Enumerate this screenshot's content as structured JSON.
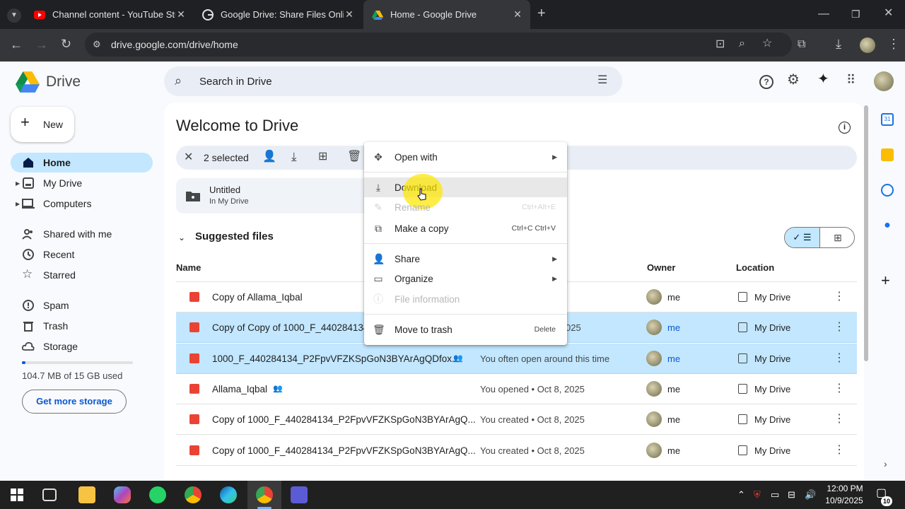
{
  "browser": {
    "tabs": [
      {
        "title": "Channel content - YouTube Stu"
      },
      {
        "title": "Google Drive: Share Files Onlin"
      },
      {
        "title": "Home - Google Drive"
      }
    ],
    "url": "drive.google.com/drive/home"
  },
  "drive": {
    "product_name": "Drive",
    "search_placeholder": "Search in Drive",
    "new_button": "New",
    "nav": [
      {
        "label": "Home"
      },
      {
        "label": "My Drive"
      },
      {
        "label": "Computers"
      },
      {
        "label": "Shared with me"
      },
      {
        "label": "Recent"
      },
      {
        "label": "Starred"
      },
      {
        "label": "Spam"
      },
      {
        "label": "Trash"
      },
      {
        "label": "Storage"
      }
    ],
    "storage_text": "104.7 MB of 15 GB used",
    "storage_fraction": 0.007,
    "get_storage_button": "Get more storage",
    "page_title": "Welcome to Drive",
    "selection_text": "2 selected",
    "folder": {
      "name": "Untitled",
      "location": "In My Drive"
    },
    "suggested_title": "Suggested files",
    "columns": {
      "name": "Name",
      "owner": "Owner",
      "location": "Location"
    },
    "files": [
      {
        "name": "Copy of Allama_Iqbal",
        "reason": "",
        "owner": "me",
        "location": "My Drive",
        "kind": "video",
        "shared": false
      },
      {
        "name": "Copy of Copy of 1000_F_440284134_",
        "reason": "025",
        "owner": "me",
        "location": "My Drive",
        "kind": "image",
        "shared": false
      },
      {
        "name": "1000_F_440284134_P2FpvVFZKSpGoN3BYArAgQDfox...",
        "reason": "You often open around this time",
        "owner": "me",
        "location": "My Drive",
        "kind": "image",
        "shared": true
      },
      {
        "name": "Allama_Iqbal",
        "reason": "You opened • Oct 8, 2025",
        "owner": "me",
        "location": "My Drive",
        "kind": "video",
        "shared": true
      },
      {
        "name": "Copy of 1000_F_440284134_P2FpvVFZKSpGoN3BYArAgQ...",
        "reason": "You created • Oct 8, 2025",
        "owner": "me",
        "location": "My Drive",
        "kind": "image",
        "shared": false
      },
      {
        "name": "Copy of 1000_F_440284134_P2FpvVFZKSpGoN3BYArAgQ...",
        "reason": "You created • Oct 8, 2025",
        "owner": "me",
        "location": "My Drive",
        "kind": "image",
        "shared": false
      }
    ],
    "row1_reason_fragment": "1",
    "context_menu": [
      {
        "label": "Open with",
        "shortcut": ""
      },
      {
        "label": "Download",
        "shortcut": ""
      },
      {
        "label": "Rename",
        "shortcut": "Ctrl+Alt+E"
      },
      {
        "label": "Make a copy",
        "shortcut": "Ctrl+C Ctrl+V"
      },
      {
        "label": "Share",
        "shortcut": ""
      },
      {
        "label": "Organize",
        "shortcut": ""
      },
      {
        "label": "File information",
        "shortcut": ""
      },
      {
        "label": "Move to trash",
        "shortcut": "Delete"
      }
    ]
  },
  "taskbar": {
    "time": "12:00 PM",
    "date": "10/9/2025",
    "notifications": "10"
  }
}
